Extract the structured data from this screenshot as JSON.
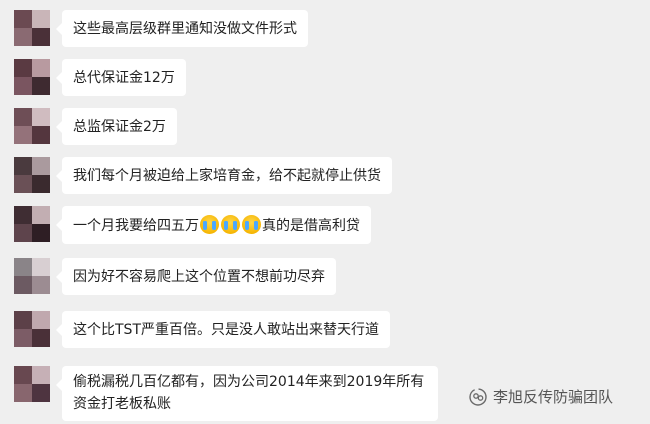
{
  "messages": [
    {
      "text": "这些最高层级群里通知没做文件形式",
      "avatar_colors": [
        "#6b4a52",
        "#c9b5b8",
        "#8a6a72",
        "#4a3038"
      ]
    },
    {
      "text": "总代保证金12万",
      "avatar_colors": [
        "#5a3a42",
        "#b89aa0",
        "#7a5560",
        "#3e2a30"
      ]
    },
    {
      "text": "总监保证金2万",
      "avatar_colors": [
        "#6e4e56",
        "#d0bcc0",
        "#94727a",
        "#54363e"
      ]
    },
    {
      "text": "我们每个月被迫给上家培育金，给不起就停止供货",
      "avatar_colors": [
        "#4a3a3e",
        "#aa9a9e",
        "#6a5056",
        "#3a2a2e"
      ]
    },
    {
      "text_before": "一个月我要给四五万",
      "emoji": "crying-face",
      "emoji_count": 3,
      "text_after": "真的是借高利贷",
      "avatar_colors": [
        "#3f2d33",
        "#c2aeb2",
        "#5e444c",
        "#2e1e24"
      ]
    },
    {
      "text": "因为好不容易爬上这个位置不想前功尽弃",
      "avatar_colors": [
        "#8a8488",
        "#d8cfd2",
        "#6c5a62",
        "#9c8c92"
      ]
    },
    {
      "text": "这个比TST严重百倍。只是没人敢站出来替天行道",
      "avatar_colors": [
        "#5c4048",
        "#c0a8ae",
        "#7c5c66",
        "#4a3038"
      ]
    },
    {
      "text": "偷税漏税几百亿都有，因为公司2014年来到2019年所有资金打老板私账",
      "avatar_colors": [
        "#684850",
        "#c6b0b6",
        "#88666e",
        "#4e3440"
      ]
    }
  ],
  "watermark": {
    "text": "李旭反传防骗团队",
    "icon": "wechat-official-account-icon"
  },
  "colors": {
    "background": "#efefef",
    "bubble": "#ffffff",
    "text": "#222222"
  }
}
